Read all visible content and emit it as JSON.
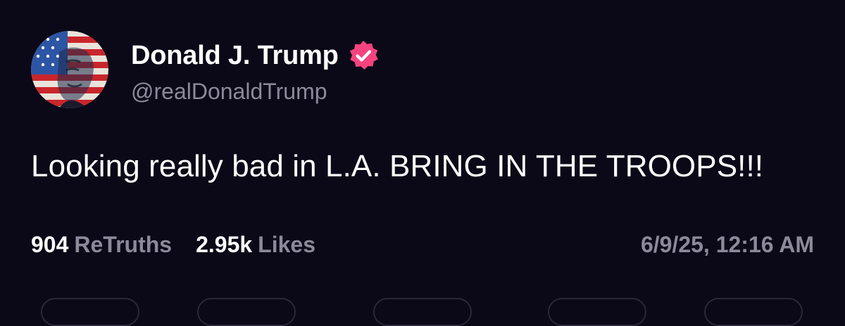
{
  "post": {
    "author": {
      "display_name": "Donald J. Trump",
      "handle": "@realDonaldTrump",
      "verified": true,
      "verified_icon": "verified-badge-icon",
      "verified_color": "#f6437f"
    },
    "text": "Looking really bad in L.A. BRING IN THE TROOPS!!!",
    "stats": {
      "retruths_count": "904",
      "retruths_label": "ReTruths",
      "likes_count": "2.95k",
      "likes_label": "Likes"
    },
    "timestamp": "6/9/25, 12:16 AM"
  },
  "theme": {
    "background": "#0b0817",
    "text_primary": "#ffffff",
    "text_secondary": "#8c8a9a"
  }
}
